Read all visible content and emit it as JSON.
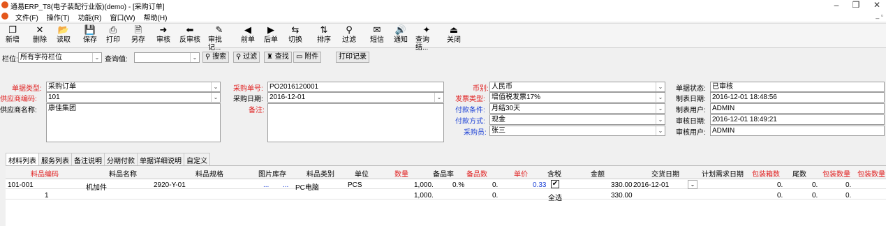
{
  "window": {
    "title": "通易ERP_T8(电子装配行业版)(demo) - [采购订单]"
  },
  "menu": [
    "文件(F)",
    "操作(T)",
    "功能(R)",
    "窗口(W)",
    "帮助(H)"
  ],
  "toolbar": [
    {
      "label": "新增",
      "icon": "new-icon",
      "glyph": "❐"
    },
    {
      "label": "删除",
      "icon": "delete-icon",
      "glyph": "✕"
    },
    {
      "label": "读取",
      "icon": "open-folder-icon",
      "glyph": "📂"
    },
    {
      "label": "保存",
      "icon": "save-icon",
      "glyph": "💾"
    },
    {
      "label": "打印",
      "icon": "print-icon",
      "glyph": "⎙"
    },
    {
      "label": "另存",
      "icon": "save-as-icon",
      "glyph": "🗎"
    },
    {
      "label": "审核",
      "icon": "approve-icon",
      "glyph": "➜"
    },
    {
      "label": "反审核",
      "icon": "unapprove-icon",
      "glyph": "⬅"
    },
    {
      "label": "审批记...",
      "icon": "approval-log-icon",
      "glyph": "✎"
    },
    {
      "label": "前单",
      "icon": "prev-icon",
      "glyph": "◀"
    },
    {
      "label": "后单",
      "icon": "next-icon",
      "glyph": "▶"
    },
    {
      "label": "切换",
      "icon": "switch-icon",
      "glyph": "⇆"
    },
    {
      "label": "排序",
      "icon": "sort-icon",
      "glyph": "⇅"
    },
    {
      "label": "过滤",
      "icon": "filter-icon",
      "glyph": "⚲"
    },
    {
      "label": "短信",
      "icon": "sms-icon",
      "glyph": "✉"
    },
    {
      "label": "通知",
      "icon": "notify-icon",
      "glyph": "🔊"
    },
    {
      "label": "查询结...",
      "icon": "query-result-icon",
      "glyph": "✦"
    },
    {
      "label": "关闭",
      "icon": "close-door-icon",
      "glyph": "⏏"
    }
  ],
  "filter": {
    "field_label": "栏位:",
    "field_value": "所有字符栏位",
    "query_label": "查询值:",
    "query_value": "",
    "search_btn": "搜索",
    "filter_btn": "过滤",
    "find_btn": "查找",
    "attach_btn": "附件",
    "print_log_btn": "打印记录"
  },
  "form": {
    "doc_type_label": "单据类型:",
    "doc_type": "采购订单",
    "supplier_code_label": "供应商编码:",
    "supplier_code": "101",
    "supplier_name_label": "供应商名称:",
    "supplier_name": "康佳集团",
    "po_no_label": "采购单号:",
    "po_no": "PO2016120001",
    "po_date_label": "采购日期:",
    "po_date": "2016-12-01",
    "remark_label": "备注:",
    "remark": "",
    "currency_label": "币别:",
    "currency": "人民币",
    "invoice_label": "发票类型:",
    "invoice": "增值税发票17%",
    "pay_terms_label": "付款条件:",
    "pay_terms": "月结30天",
    "pay_method_label": "付款方式:",
    "pay_method": "现金",
    "buyer_label": "采购员:",
    "buyer": "张三",
    "status_label": "单据状态:",
    "status": "已审核",
    "created_label": "制表日期:",
    "created": "2016-12-01 18:48:56",
    "creator_label": "制表用户:",
    "creator": "ADMIN",
    "approved_label": "审核日期:",
    "approved": "2016-12-01 18:49:21",
    "approver_label": "审核用户:",
    "approver": "ADMIN"
  },
  "tabs": [
    "材料列表",
    "服务列表",
    "备注说明",
    "分期付款",
    "单据详细说明",
    "自定义"
  ],
  "grid": {
    "headers": [
      "料品编码",
      "料品名称",
      "料品规格",
      "图片",
      "库存",
      "料品类别",
      "单位",
      "数量",
      "备品率",
      "备品数",
      "单价",
      "含税",
      "金额",
      "交货日期",
      "计划需求日期",
      "包装箱数",
      "尾数",
      "包装数量",
      "包装数量"
    ],
    "row": {
      "code": "101-001",
      "name": "机加件",
      "spec": "2920-Y-01",
      "pic": "...",
      "stock": "...",
      "category": "PC电脑",
      "unit": "PCS",
      "qty": "1,000.",
      "spare_rate": "0.%",
      "spare_qty": "0.",
      "price": "0.33",
      "tax": "✔",
      "amount": "330.00",
      "delivery": "2016-12-01",
      "plan": "",
      "boxes": "0.",
      "remainder": "0.",
      "pack_qty": "0."
    },
    "total": {
      "count": "1",
      "qty": "1,000.",
      "spare_qty": "0.",
      "select_all": "全选",
      "amount": "330.00",
      "boxes": "0.",
      "remainder": "0.",
      "pack_qty": "0."
    }
  },
  "colors": {
    "required": "#e02020",
    "link": "#1a3fd6"
  }
}
